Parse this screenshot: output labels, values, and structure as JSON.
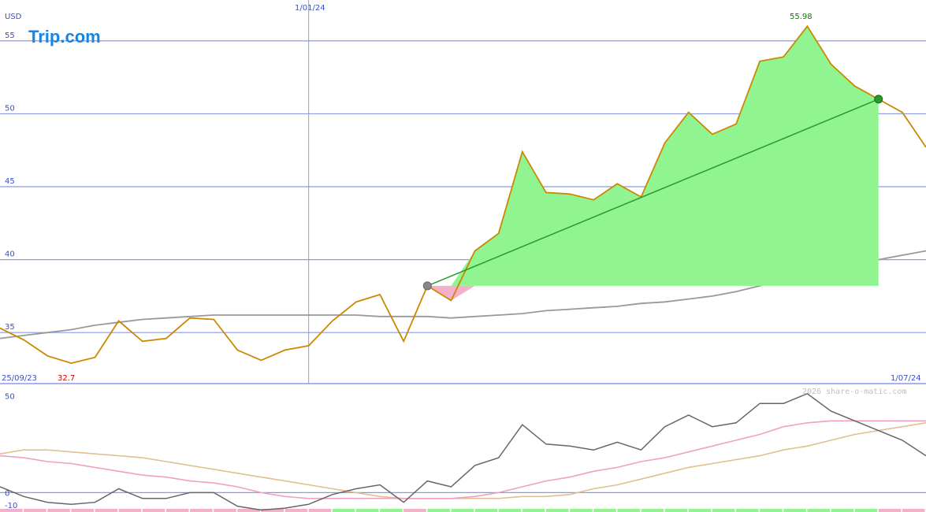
{
  "logo": {
    "text_a": "Trip",
    "text_b": ".com",
    "color": "#1a84e0",
    "dot_color": "#f5a623"
  },
  "watermark": "2026 share-o-matic.com",
  "colors": {
    "grid": "#8a9ae8",
    "axis_text": "#3a4fc8",
    "price": "#cc8800",
    "ma": "#999999",
    "gain_fill": "#90f590",
    "loss_fill": "#f4b0c8",
    "trend": "#2a9a2a",
    "high_text": "#008000",
    "low_text": "#cc0000",
    "osc_line": "#666666",
    "osc_signal": "#f0a0c0",
    "osc_slow": "#e0c090"
  },
  "chart_data": [
    {
      "type": "line",
      "title": "",
      "currency_label": "USD",
      "ylim": [
        31.5,
        57.8
      ],
      "y_ticks": [
        35,
        40,
        45,
        50,
        55
      ],
      "x_labels": {
        "start": "25/09/23",
        "mid": "1/01/24",
        "end": "1/07/24"
      },
      "high_label": "55.98",
      "low_label": "32.7",
      "mid_marker_index": 13,
      "series": [
        {
          "values": [
            35.3,
            34.5,
            33.4,
            32.9,
            33.3,
            35.8,
            34.4,
            34.6,
            36.0,
            35.9,
            33.8,
            33.1,
            33.8,
            34.1,
            35.8,
            37.1,
            37.6,
            34.4,
            38.2,
            37.2,
            40.6,
            41.8,
            47.4,
            44.6,
            44.5,
            44.1,
            45.2,
            44.3,
            48.0,
            50.1,
            48.6,
            49.3,
            53.6,
            53.9,
            56.0,
            53.4,
            51.9,
            51.0,
            50.1,
            47.7
          ]
        },
        {
          "values": [
            34.6,
            34.8,
            35.0,
            35.2,
            35.5,
            35.7,
            35.9,
            36.0,
            36.1,
            36.2,
            36.2,
            36.2,
            36.2,
            36.2,
            36.2,
            36.2,
            36.1,
            36.1,
            36.1,
            36.0,
            36.1,
            36.2,
            36.3,
            36.5,
            36.6,
            36.7,
            36.8,
            37.0,
            37.1,
            37.3,
            37.5,
            37.8,
            38.2,
            38.6,
            39.0,
            39.4,
            39.7,
            40.0,
            40.3,
            40.6
          ]
        }
      ],
      "trade": {
        "entry_index": 18,
        "entry_value": 38.2,
        "exit_index": 37,
        "exit_value": 51.0
      }
    },
    {
      "type": "line",
      "title": "",
      "ylim": [
        -10,
        55
      ],
      "y_ticks": [
        50,
        0,
        -10
      ],
      "series": [
        {
          "values": [
            3,
            -2,
            -5,
            -6,
            -5,
            2,
            -3,
            -3,
            0,
            0,
            -7,
            -9,
            -8,
            -6,
            -1,
            2,
            4,
            -5,
            6,
            3,
            14,
            18,
            35,
            25,
            24,
            22,
            26,
            22,
            34,
            40,
            34,
            36,
            46,
            46,
            51,
            42,
            37,
            32,
            27,
            19
          ]
        },
        {
          "values": [
            19,
            18,
            16,
            15,
            13,
            11,
            9,
            8,
            6,
            5,
            3,
            0,
            -2,
            -3,
            -3,
            -3,
            -3,
            -3,
            -3,
            -3,
            -2,
            0,
            3,
            6,
            8,
            11,
            13,
            16,
            18,
            21,
            24,
            27,
            30,
            34,
            36,
            37,
            37,
            37,
            37,
            37
          ]
        },
        {
          "values": [
            20,
            22,
            22,
            21,
            20,
            19,
            18,
            16,
            14,
            12,
            10,
            8,
            6,
            4,
            2,
            0,
            -2,
            -3,
            -3,
            -3,
            -3,
            -3,
            -2,
            -2,
            -1,
            2,
            4,
            7,
            10,
            13,
            15,
            17,
            19,
            22,
            24,
            27,
            30,
            32,
            34,
            36
          ]
        }
      ]
    }
  ]
}
